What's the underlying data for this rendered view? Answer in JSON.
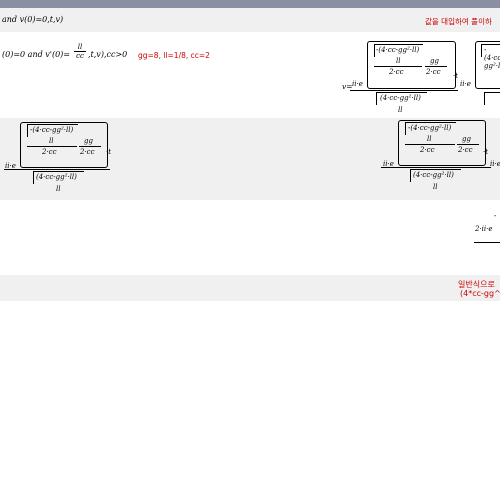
{
  "row1": {
    "left_text": "and v(0)=0,t,v)",
    "right_note": "값을 대입하여 풀이하"
  },
  "row2": {
    "left_text": "(0)=0 and v'(0)=",
    "frac_num": "ll",
    "frac_den": "cc",
    "tail": ",t,v),cc>0",
    "params": "gg=8, ll=1/8, cc=2"
  },
  "expr": {
    "v_eq": "v=",
    "ii_e": "ii·e",
    "inner_top": "-(4·cc-gg²·ll)",
    "ll": "ll",
    "two_cc": "2·cc",
    "gg": "gg",
    "dot_t": "·t",
    "sqrt_den": "(4·cc-gg²·ll)"
  },
  "row_bottom": {
    "two_ii_e": "2·ii·e"
  },
  "general": {
    "line1": "일반식으로",
    "line2": "(4*cc-gg^2"
  }
}
